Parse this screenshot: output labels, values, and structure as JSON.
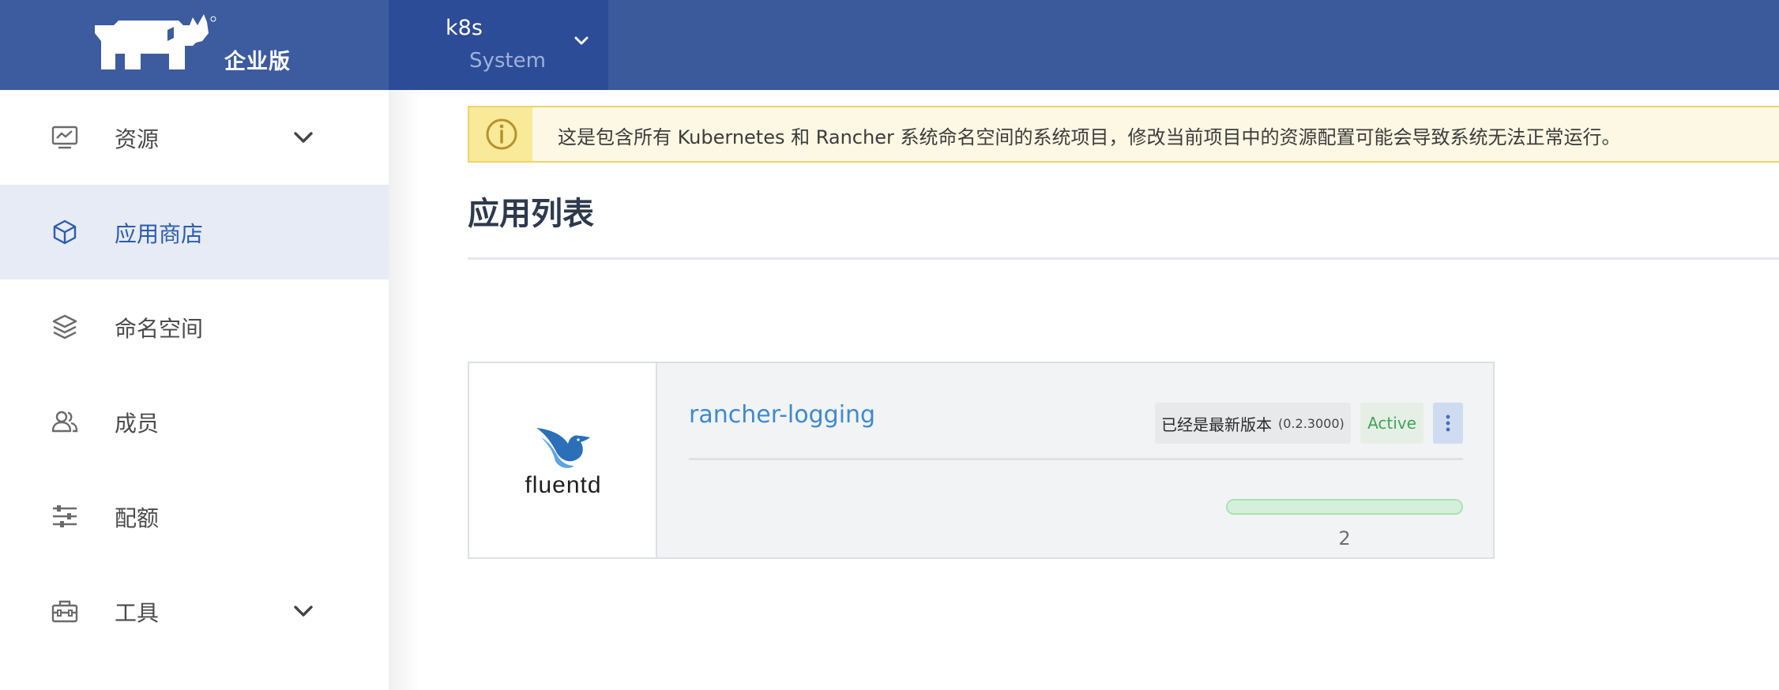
{
  "header": {
    "logo_text": "企业版",
    "cluster_name": "k8s",
    "project_name": "System"
  },
  "sidebar": {
    "items": [
      {
        "label": "资源",
        "icon": "monitor-chart-icon",
        "expandable": true,
        "active": false
      },
      {
        "label": "应用商店",
        "icon": "cube-icon",
        "expandable": false,
        "active": true
      },
      {
        "label": "命名空间",
        "icon": "layers-icon",
        "expandable": false,
        "active": false
      },
      {
        "label": "成员",
        "icon": "users-icon",
        "expandable": false,
        "active": false
      },
      {
        "label": "配额",
        "icon": "sliders-icon",
        "expandable": false,
        "active": false
      },
      {
        "label": "工具",
        "icon": "toolbox-icon",
        "expandable": true,
        "active": false
      }
    ]
  },
  "banner": {
    "text": "这是包含所有 Kubernetes 和 Rancher 系统命名空间的系统项目，修改当前项目中的资源配置可能会导致系统无法正常运行。",
    "icon": "info-icon"
  },
  "main": {
    "title": "应用列表",
    "apps": [
      {
        "logo_text": "fluentd",
        "name": "rancher-logging",
        "version_label": "已经是最新版本",
        "version": "(0.2.3000)",
        "state": "Active",
        "progress": 1.0,
        "pod_count": "2"
      }
    ]
  },
  "colors": {
    "header": "#3a5a9b",
    "project_switcher": "#2c4c97",
    "active_nav_bg": "#e6ebf5",
    "active_nav_text": "#2c5cad",
    "link": "#3d8ad0",
    "state_active": "#3fa455",
    "banner_bg": "#fcf8e3",
    "banner_border": "#efd46d"
  }
}
